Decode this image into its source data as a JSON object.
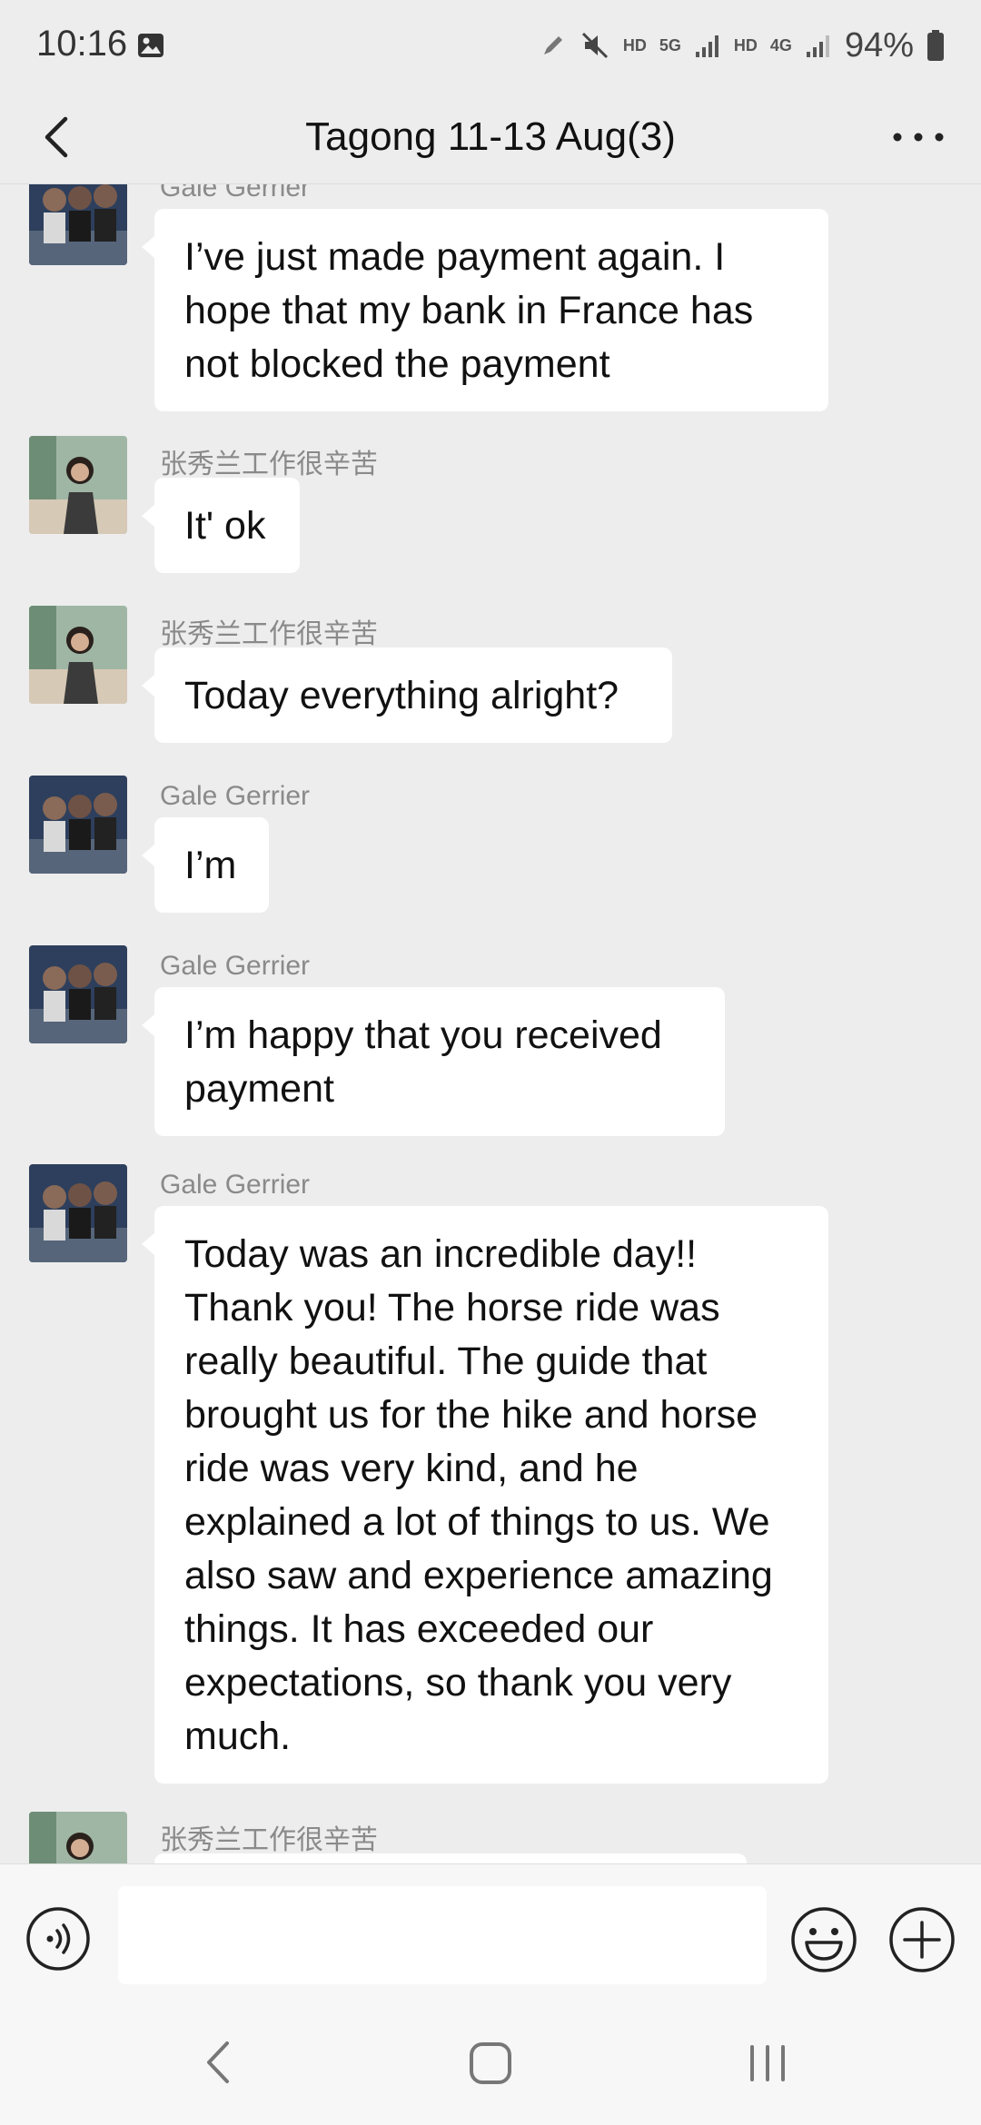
{
  "status_bar": {
    "time": "10:16",
    "hd1": "HD",
    "net1": "5G",
    "hd2": "HD",
    "net2": "4G",
    "battery": "94%"
  },
  "header": {
    "title": "Tagong 11-13 Aug(3)"
  },
  "messages": [
    {
      "sender": "Gale Gerrier",
      "avatar": "group-photo",
      "text": "I’ve just made payment again. I hope that my bank in France has not blocked the payment"
    },
    {
      "sender": "张秀兰工作很辛苦",
      "avatar": "woman-photo",
      "text": "It' ok"
    },
    {
      "sender": "张秀兰工作很辛苦",
      "avatar": "woman-photo",
      "text": "Today everything alright?"
    },
    {
      "sender": "Gale Gerrier",
      "avatar": "group-photo",
      "text": "I’m"
    },
    {
      "sender": "Gale Gerrier",
      "avatar": "group-photo",
      "text": "I’m happy that you received payment"
    },
    {
      "sender": "Gale Gerrier",
      "avatar": "group-photo",
      "text": "Today was an incredible day!! Thank you! The horse ride was really beautiful. The guide that brought us for the hike and horse ride was very kind, and he explained a lot of things to us. We also saw and experience amazing things. It has exceeded our expectations, so thank you very much."
    },
    {
      "sender": "张秀兰工作很辛苦",
      "avatar": "woman-photo",
      "text": ""
    }
  ],
  "input": {
    "value": "",
    "placeholder": ""
  },
  "icons": {
    "back": "chevron-left-icon",
    "more": "more-dots-icon",
    "voice": "voice-icon",
    "emoji": "emoji-icon",
    "plus": "plus-icon"
  },
  "colors": {
    "background": "#ededed",
    "bubble": "#ffffff",
    "sender": "#8a8a8a"
  }
}
